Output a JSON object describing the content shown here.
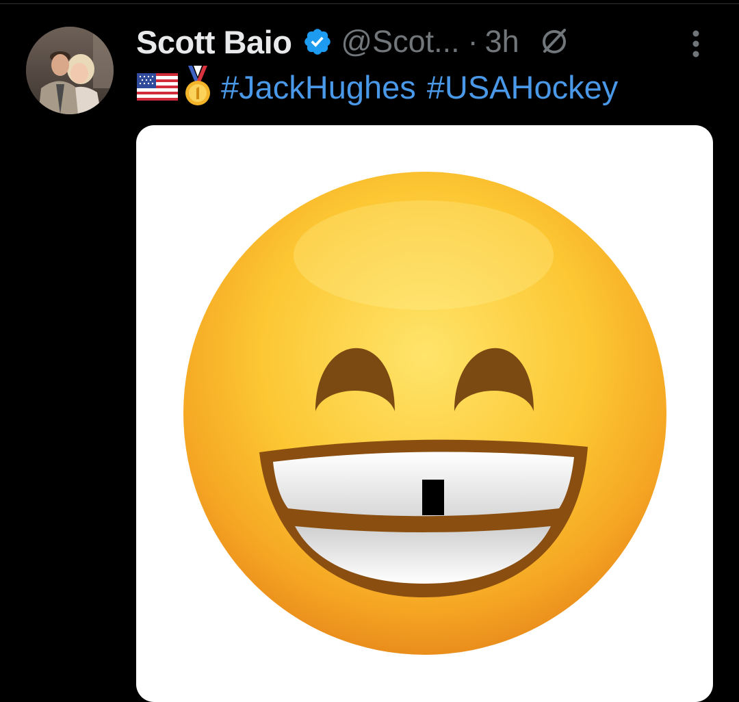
{
  "post": {
    "author": {
      "display_name": "Scott Baio",
      "handle": "@Scot...",
      "verified": true
    },
    "separator": "·",
    "time": "3h",
    "icons": {
      "verified": "verified-badge-icon",
      "reply_restricted": "no-reply-icon",
      "more": "more-vertical-icon",
      "emoji_1": "us-flag-icon",
      "emoji_2": "first-place-medal-icon",
      "media": "grinning-face-missing-tooth-emoji"
    },
    "hashtags": [
      "#JackHughes",
      "#USAHockey"
    ]
  },
  "colors": {
    "background": "#000000",
    "name": "#e7e9ea",
    "muted": "#71767b",
    "link": "#4a98e8",
    "verified": "#1d9bf0"
  }
}
